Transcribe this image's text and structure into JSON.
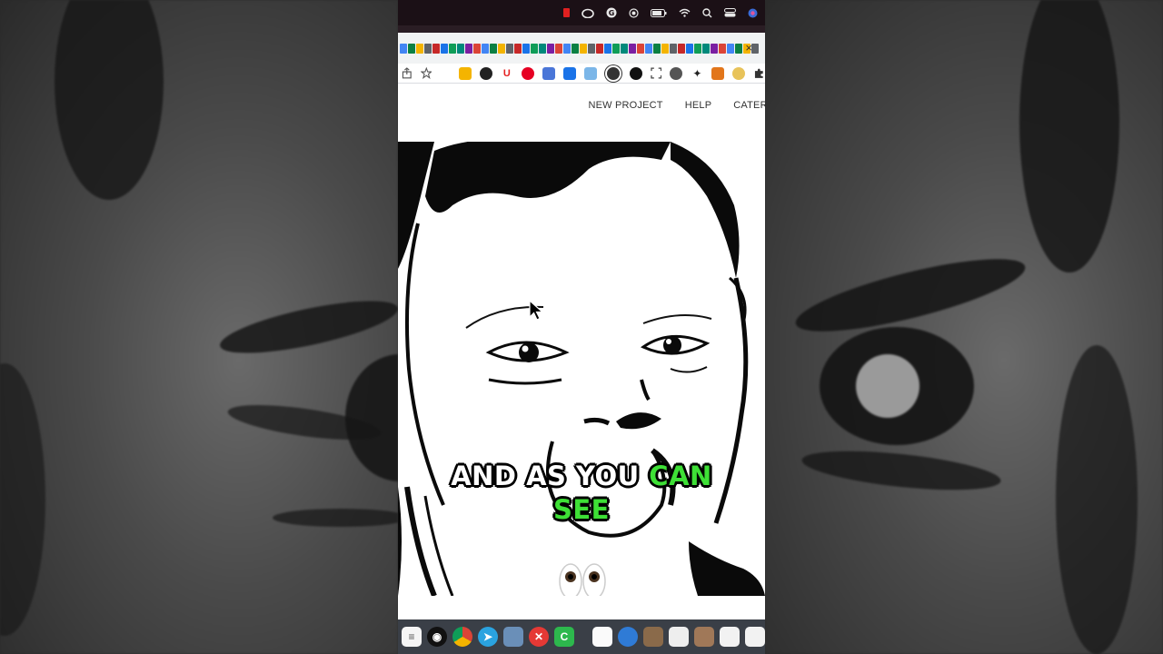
{
  "site_nav": {
    "items": [
      "NEW PROJECT",
      "HELP",
      "CATERI"
    ]
  },
  "caption": {
    "line1_plain": "AND AS YOU ",
    "line1_highlight": "CAN",
    "line2_highlight": "SEE",
    "highlight_color": "#3ee036"
  },
  "browser": {
    "tab_close_icon": "×",
    "toolbar_icons": [
      "share-icon",
      "star-icon"
    ]
  },
  "menubar": {
    "icons": [
      "record-icon",
      "creative-cloud-icon",
      "grammarly-icon",
      "screen-record-icon",
      "battery-icon",
      "wifi-icon",
      "search-icon",
      "control-center-icon",
      "siri-icon"
    ]
  },
  "dock": {
    "apps": [
      "notes-app",
      "camera-app",
      "chrome-app",
      "telegram-app",
      "preview-app",
      "close-app",
      "facetime-app",
      "document-file",
      "globe-app",
      "photo-thumb",
      "file-thumb",
      "photo-thumb",
      "doc-thumb",
      "doc-thumb"
    ]
  },
  "colors": {
    "menubar_bg": "#1b1016",
    "dock_bg": "#3a3f47",
    "caption_green": "#3ee036"
  }
}
